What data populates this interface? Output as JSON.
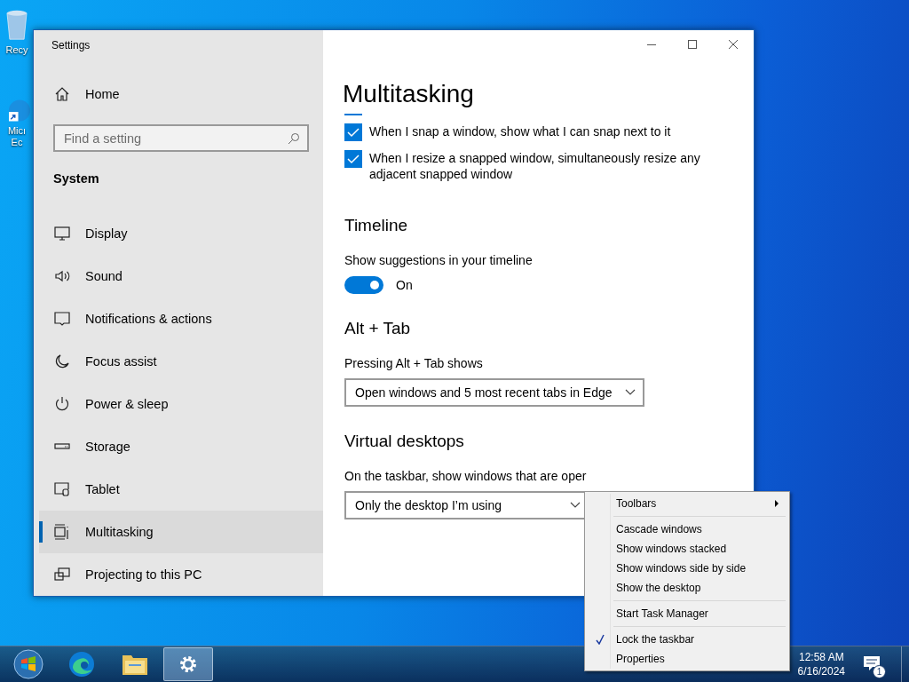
{
  "desktop": {
    "icons": [
      {
        "lines": [
          "Recy"
        ]
      },
      {
        "lines": [
          "Micı",
          "Ec"
        ]
      }
    ]
  },
  "window": {
    "title": "Settings"
  },
  "sidebar": {
    "home": "Home",
    "search": {
      "placeholder": "Find a setting"
    },
    "section": "System",
    "items": [
      {
        "label": "Display",
        "selected": false
      },
      {
        "label": "Sound",
        "selected": false
      },
      {
        "label": "Notifications & actions",
        "selected": false
      },
      {
        "label": "Focus assist",
        "selected": false
      },
      {
        "label": "Power & sleep",
        "selected": false
      },
      {
        "label": "Storage",
        "selected": false
      },
      {
        "label": "Tablet",
        "selected": false
      },
      {
        "label": "Multitasking",
        "selected": true
      },
      {
        "label": "Projecting to this PC",
        "selected": false
      }
    ]
  },
  "content": {
    "title": "Multitasking",
    "checkboxes": [
      {
        "label": "When I snap a window, show what I can snap next to it",
        "checked": true
      },
      {
        "label": "When I resize a snapped window, simultaneously resize any adjacent snapped window",
        "checked": true
      }
    ],
    "sections": [
      {
        "heading": "Timeline",
        "label": "Show suggestions in your timeline",
        "kind": "toggle",
        "on": true,
        "state_text": "On"
      },
      {
        "heading": "Alt + Tab",
        "label": "Pressing Alt + Tab shows",
        "kind": "dropdown",
        "value": "Open windows and 5 most recent tabs in Edge"
      },
      {
        "heading": "Virtual desktops",
        "label": "On the taskbar, show windows that are oper",
        "kind": "dropdown",
        "value": "Only the desktop I’m using"
      }
    ]
  },
  "context_menu": {
    "groups": [
      [
        {
          "label": "Toolbars",
          "checked": false,
          "submenu": true
        }
      ],
      [
        {
          "label": "Cascade windows",
          "checked": false,
          "submenu": false
        },
        {
          "label": "Show windows stacked",
          "checked": false,
          "submenu": false
        },
        {
          "label": "Show windows side by side",
          "checked": false,
          "submenu": false
        },
        {
          "label": "Show the desktop",
          "checked": false,
          "submenu": false
        }
      ],
      [
        {
          "label": "Start Task Manager",
          "checked": false,
          "submenu": false
        }
      ],
      [
        {
          "label": "Lock the taskbar",
          "checked": true,
          "submenu": false
        },
        {
          "label": "Properties",
          "checked": false,
          "submenu": false
        }
      ]
    ]
  },
  "taskbar": {
    "buttons": [
      {
        "kind": "start",
        "active": false
      },
      {
        "kind": "edge",
        "active": false
      },
      {
        "kind": "explorer",
        "active": false
      },
      {
        "kind": "settings",
        "active": true
      }
    ],
    "time": "12:58 AM",
    "date": "6/16/2024",
    "notification_count": "1"
  }
}
